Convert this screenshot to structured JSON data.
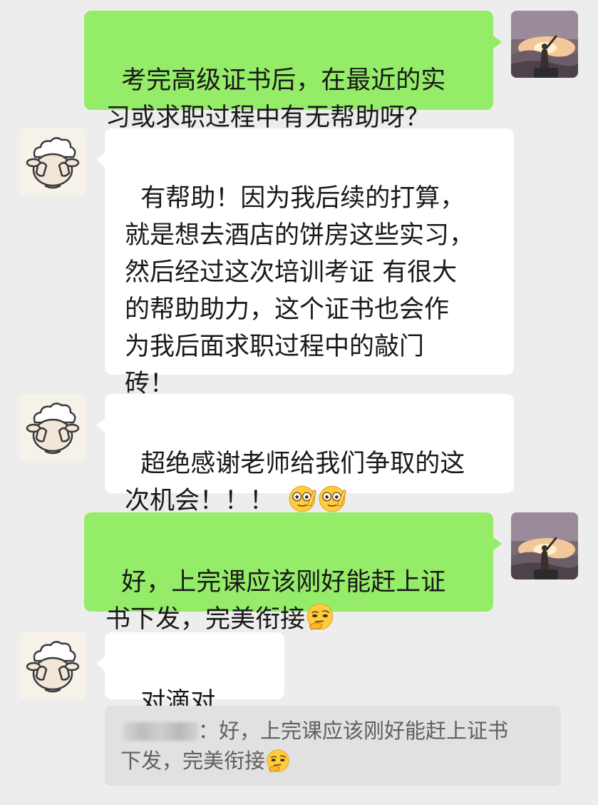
{
  "messages": [
    {
      "sender": "me",
      "text": "考完高级证书后，在最近的实\n习或求职过程中有无帮助呀？"
    },
    {
      "sender": "other",
      "text": "有帮助！因为我后续的打算，\n就是想去酒店的饼房这些实习，\n然后经过这次培训考证 有很大\n的帮助助力，这个证书也会作\n为我后面求职过程中的敲门\n砖！"
    },
    {
      "sender": "other",
      "text": "超绝感谢老师给我们争取的这\n次机会！！！",
      "emojis": [
        "salute-face-emoji",
        "salute-face-emoji"
      ]
    },
    {
      "sender": "me",
      "text": "好，上完课应该刚好能赶上证\n书下发，完美衔接",
      "emojis": [
        "thinking-face-emoji"
      ]
    },
    {
      "sender": "other",
      "text": "对滴对滴！"
    }
  ],
  "quote": {
    "text": "：好，上完课应该刚好能赶上证书\n下发，完美衔接",
    "emojis": [
      "thinking-face-emoji"
    ]
  },
  "colors": {
    "background": "#ededed",
    "my_bubble": "#95ec69",
    "their_bubble": "#ffffff",
    "quote_bg": "#e1e1e1"
  }
}
